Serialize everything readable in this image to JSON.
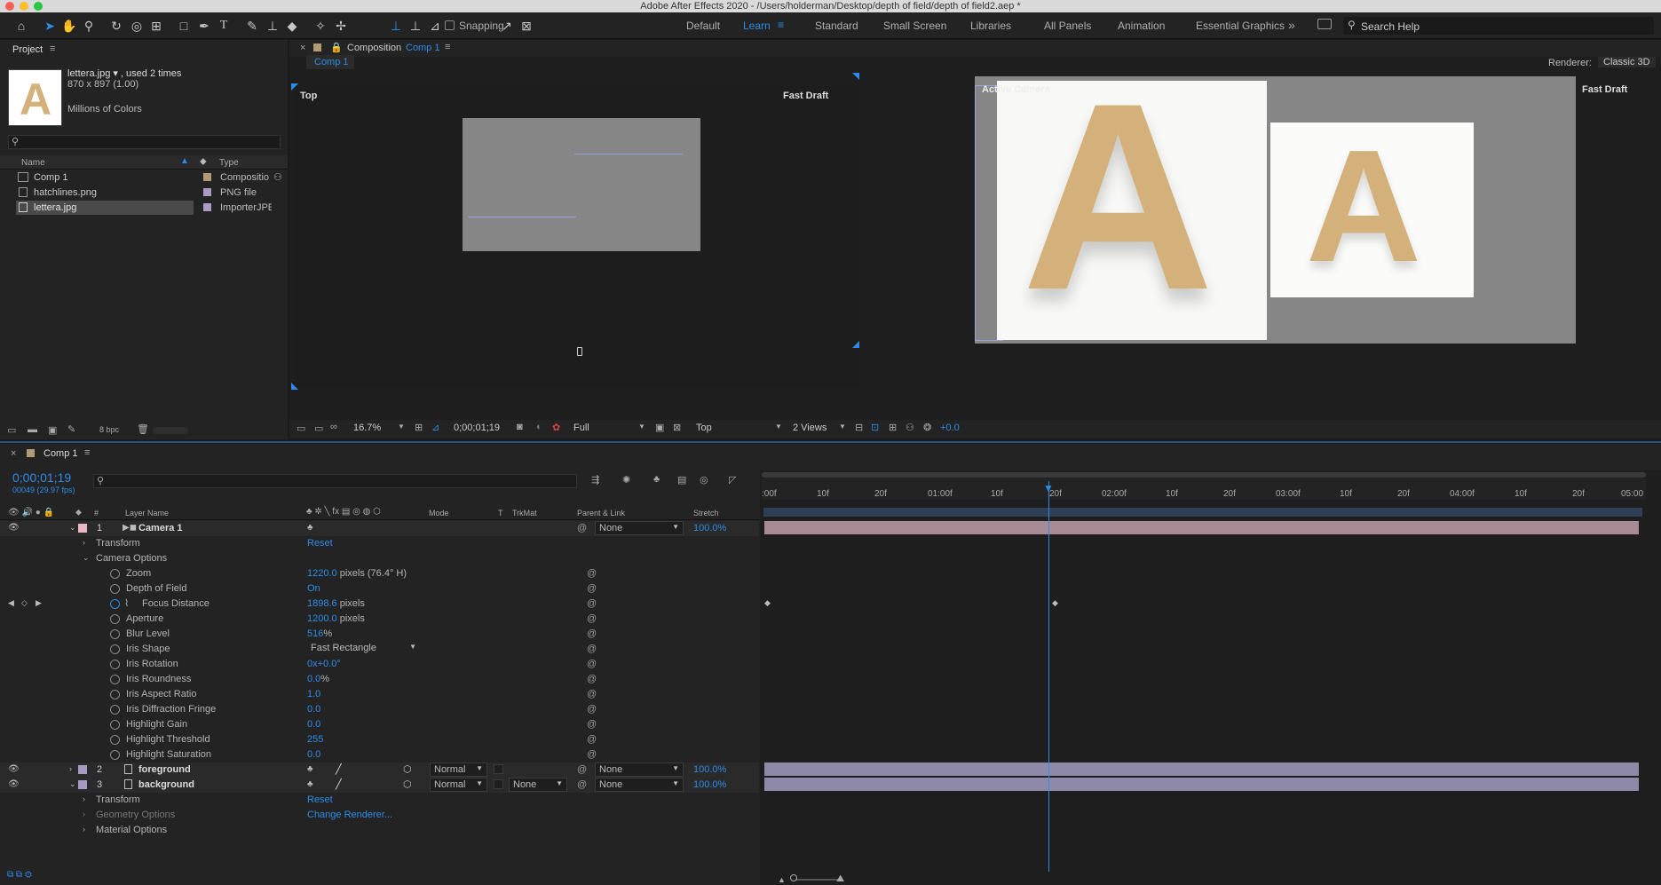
{
  "app": {
    "title": "Adobe After Effects 2020 - /Users/holderman/Desktop/depth of field/depth of field2.aep *"
  },
  "toolbar": {
    "snapping_label": "Snapping",
    "workspaces": [
      "Default",
      "Learn",
      "Standard",
      "Small Screen",
      "Libraries",
      "All Panels",
      "Animation",
      "Essential Graphics"
    ],
    "active_workspace": "Learn",
    "search_placeholder": "Search Help"
  },
  "project": {
    "panel_title": "Project",
    "selected_name": "lettera.jpg ▾ , used 2 times",
    "dimensions": "870 x 897 (1.00)",
    "color_info": "Millions of Colors",
    "thumb_letter": "A",
    "col_name": "Name",
    "col_type": "Type",
    "items": [
      {
        "name": "Comp 1",
        "type": "Compositio",
        "color": "#b19a74"
      },
      {
        "name": "hatchlines.png",
        "type": "PNG file",
        "color": "#a79bc4"
      },
      {
        "name": "lettera.jpg",
        "type": "ImporterJPE",
        "color": "#a79bc4"
      }
    ],
    "bpc": "8 bpc"
  },
  "composition": {
    "panel_prefix": "Composition",
    "comp_name": "Comp 1",
    "tab": "Comp 1",
    "renderer_label": "Renderer:",
    "renderer_value": "Classic 3D",
    "left_view": "Top",
    "right_view": "Active Camera",
    "fast_draft": "Fast Draft",
    "letter": "A",
    "zoom": "16.7%",
    "timecode": "0;00;01;19",
    "resolution": "Full",
    "view": "Top",
    "views": "2 Views",
    "exposure": "+0.0"
  },
  "timeline": {
    "tab": "Comp 1",
    "timecode": "0;00;01;19",
    "frame_info": "00049 (29.97 fps)",
    "col_num": "#",
    "col_layer": "Layer Name",
    "col_mode": "Mode",
    "col_t": "T",
    "col_trkmat": "TrkMat",
    "col_parent": "Parent & Link",
    "col_stretch": "Stretch",
    "ruler": [
      ":00f",
      "10f",
      "20f",
      "01:00f",
      "10f",
      "20f",
      "02:00f",
      "10f",
      "20f",
      "03:00f",
      "10f",
      "20f",
      "04:00f",
      "10f",
      "20f",
      "05:00"
    ],
    "layer1": {
      "num": "1",
      "name": "Camera 1",
      "parent": "None",
      "stretch": "100.0%"
    },
    "transform_label": "Transform",
    "reset_label": "Reset",
    "camera_options_label": "Camera Options",
    "properties": [
      {
        "name": "Zoom",
        "value": "1220.0",
        "suffix": " pixels (76.4° H)"
      },
      {
        "name": "Depth of Field",
        "value": "On",
        "suffix": ""
      },
      {
        "name": "Focus Distance",
        "value": "1898.6",
        "suffix": " pixels"
      },
      {
        "name": "Aperture",
        "value": "1200.0",
        "suffix": " pixels"
      },
      {
        "name": "Blur Level",
        "value": "516",
        "suffix": "%"
      },
      {
        "name": "Iris Shape",
        "value": "Fast Rectangle",
        "suffix": ""
      },
      {
        "name": "Iris Rotation",
        "value": "0x+0.0°",
        "suffix": ""
      },
      {
        "name": "Iris Roundness",
        "value": "0.0",
        "suffix": "%"
      },
      {
        "name": "Iris Aspect Ratio",
        "value": "1.0",
        "suffix": ""
      },
      {
        "name": "Iris Diffraction Fringe",
        "value": "0.0",
        "suffix": ""
      },
      {
        "name": "Highlight Gain",
        "value": "0.0",
        "suffix": ""
      },
      {
        "name": "Highlight Threshold",
        "value": "255",
        "suffix": ""
      },
      {
        "name": "Highlight Saturation",
        "value": "0.0",
        "suffix": ""
      }
    ],
    "layer2": {
      "num": "2",
      "name": "foreground",
      "mode": "Normal",
      "parent": "None",
      "stretch": "100.0%"
    },
    "layer3": {
      "num": "3",
      "name": "background",
      "mode": "Normal",
      "trkmat": "None",
      "parent": "None",
      "stretch": "100.0%"
    },
    "geometry_options": "Geometry Options",
    "change_renderer": "Change Renderer...",
    "material_options": "Material Options"
  }
}
